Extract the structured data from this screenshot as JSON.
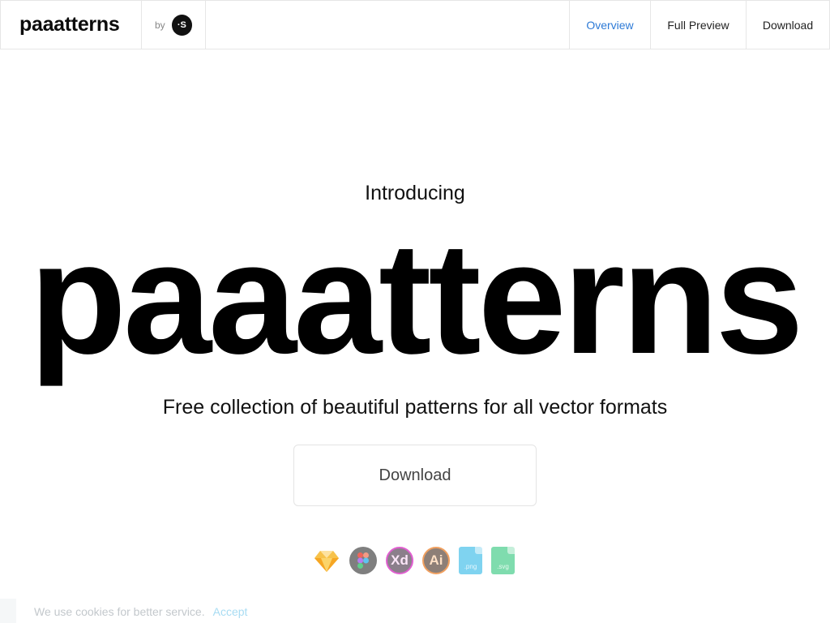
{
  "header": {
    "brand": "paaatterns",
    "by_label": "by",
    "by_logo_text": "·S",
    "nav": [
      {
        "label": "Overview",
        "active": true
      },
      {
        "label": "Full Preview",
        "active": false
      },
      {
        "label": "Download",
        "active": false
      }
    ]
  },
  "hero": {
    "intro": "Introducing",
    "title": "paaatterns",
    "subtitle": "Free collection of beautiful patterns for all vector formats",
    "download_label": "Download"
  },
  "formats": [
    {
      "icon": "sketch-icon",
      "label": ""
    },
    {
      "icon": "figma-icon",
      "label": ""
    },
    {
      "icon": "xd-icon",
      "label": "Xd"
    },
    {
      "icon": "illustrator-icon",
      "label": "Ai"
    },
    {
      "icon": "png-file-icon",
      "label": ".png"
    },
    {
      "icon": "svg-file-icon",
      "label": ".svg"
    }
  ],
  "cookie": {
    "text": "We use cookies for better service.",
    "accept_label": "Accept"
  },
  "colors": {
    "accent": "#2d7ad6",
    "border": "#e6e6e6"
  }
}
